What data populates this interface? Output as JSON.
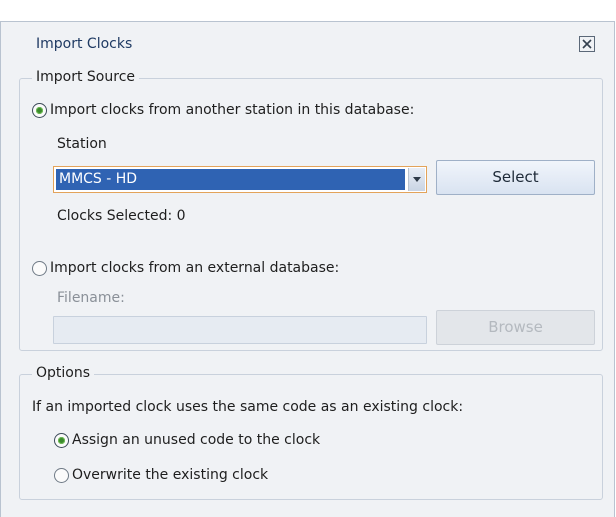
{
  "dialog": {
    "title": "Import Clocks",
    "close_icon": "close-x-icon"
  },
  "import_source": {
    "legend": "Import Source",
    "option_station": {
      "label": "Import clocks from another station in this database:",
      "checked": true
    },
    "station_label": "Station",
    "station_select": {
      "value": "MMCS - HD"
    },
    "select_button": "Select",
    "clocks_selected": "Clocks Selected: 0",
    "option_external": {
      "label": "Import clocks from an external database:",
      "checked": false
    },
    "filename_label": "Filename:",
    "filename_value": "",
    "browse_button": "Browse"
  },
  "options": {
    "legend": "Options",
    "description": "If an imported clock uses the same code as an existing clock:",
    "option_assign": {
      "label": "Assign an unused code to the clock",
      "checked": true
    },
    "option_overwrite": {
      "label": "Overwrite the existing clock",
      "checked": false
    }
  },
  "colors": {
    "selection": "#2f63b3",
    "radio_dot": "#3b8a2c",
    "focus_border": "#e3a35a"
  }
}
